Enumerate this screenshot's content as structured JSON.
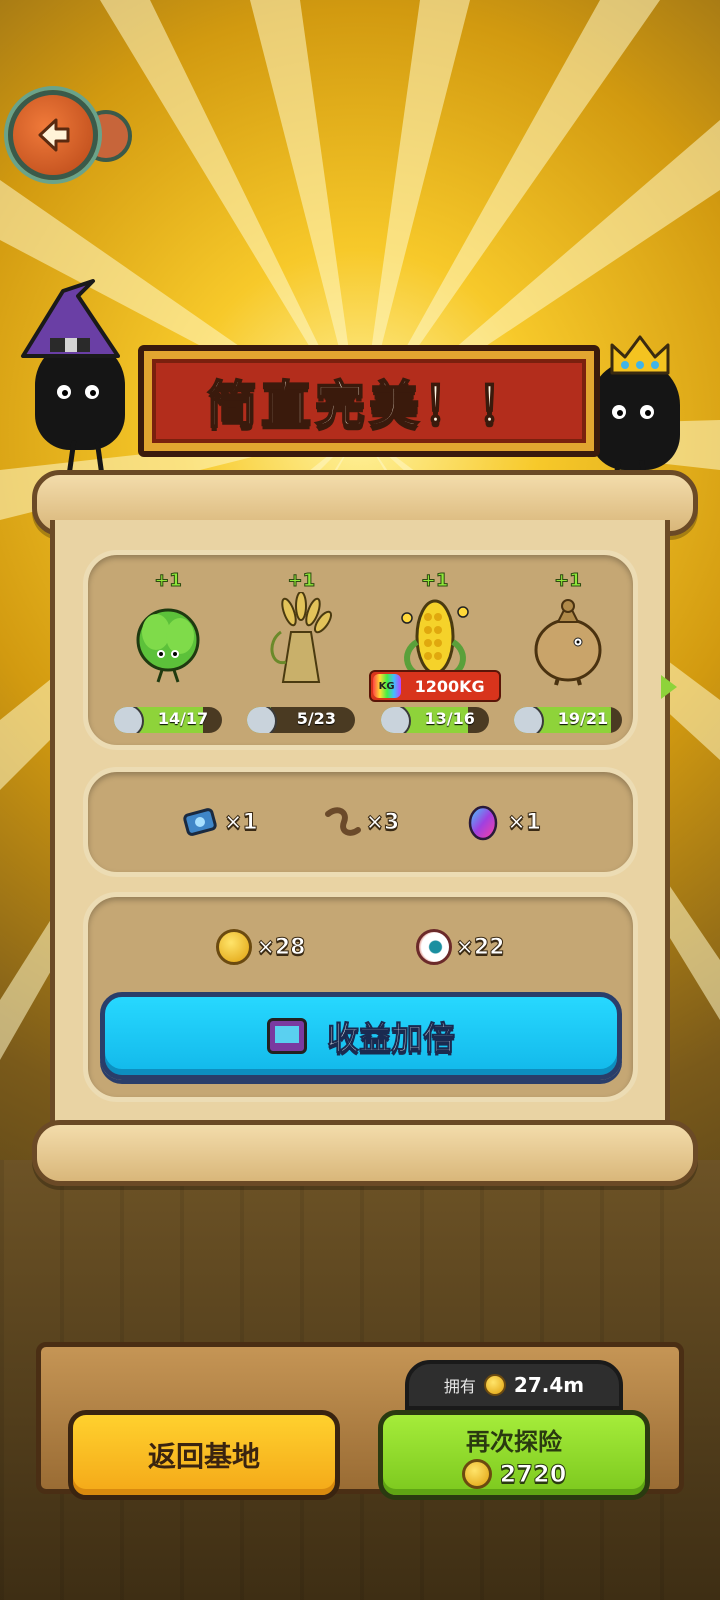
{
  "banner": {
    "title": "简直完美！！"
  },
  "harvest": {
    "items": [
      {
        "name": "lettuce-creature-icon",
        "bonus": "+1",
        "count": "14/17",
        "progress": 0.82
      },
      {
        "name": "wheat-bundle-icon",
        "bonus": "+1",
        "count": "5/23",
        "progress": 0.22
      },
      {
        "name": "corn-icon",
        "bonus": "+1",
        "count": "13/16",
        "progress": 0.81,
        "weight": "1200KG",
        "weight_icon": "KG"
      },
      {
        "name": "sack-creature-icon",
        "bonus": "+1",
        "count": "19/21",
        "progress": 0.9
      }
    ]
  },
  "loot": [
    {
      "icon": "blue-machine-part-icon",
      "qty": "×1"
    },
    {
      "icon": "worm-icon",
      "qty": "×3"
    },
    {
      "icon": "rainbow-egg-icon",
      "qty": "×1"
    }
  ],
  "rewards": {
    "coins": "×28",
    "eyeballs": "×22",
    "double_button": "收益加倍"
  },
  "bottom": {
    "own_label": "拥有",
    "own_value": "27.4m",
    "return_button": "返回基地",
    "again_button": "再次探险",
    "again_cost": "2720"
  },
  "colors": {
    "accent_blue": "#12b8ea",
    "accent_green": "#8ed33a",
    "accent_yellow": "#ffd12e",
    "banner_red": "#b32d1c"
  }
}
